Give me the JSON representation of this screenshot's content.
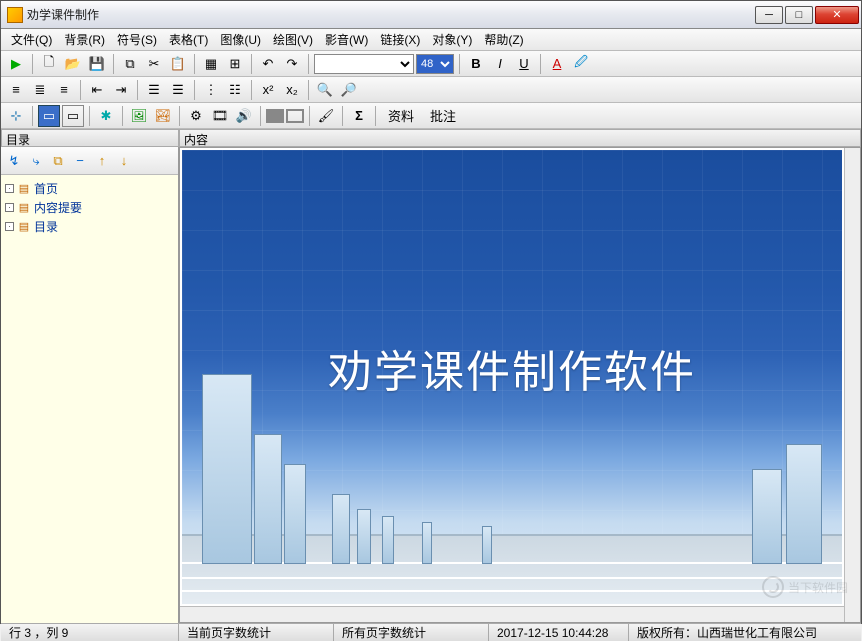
{
  "window": {
    "title": "劝学课件制作"
  },
  "menu": {
    "items": [
      "文件(Q)",
      "背景(R)",
      "符号(S)",
      "表格(T)",
      "图像(U)",
      "绘图(V)",
      "影音(W)",
      "链接(X)",
      "对象(Y)",
      "帮助(Z)"
    ]
  },
  "toolbar1": {
    "font_size": "48"
  },
  "toolbar3": {
    "ziliao": "资料",
    "pizhu": "批注"
  },
  "sidebar": {
    "header": "目录",
    "items": [
      {
        "label": "首页"
      },
      {
        "label": "内容提要"
      },
      {
        "label": "目录"
      }
    ]
  },
  "content": {
    "header": "内容",
    "slide_title": "劝学课件制作软件"
  },
  "statusbar": {
    "cursor": "行 3 ，列 9",
    "current_page_stats": "当前页字数统计",
    "all_pages_stats": "所有页字数统计",
    "datetime": "2017-12-15 10:44:28",
    "copyright": "版权所有：山西瑞世化工有限公司"
  },
  "watermark": "当下软件园"
}
